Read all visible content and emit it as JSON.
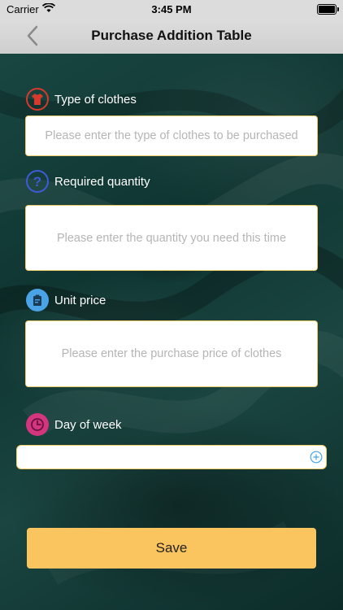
{
  "status_bar": {
    "carrier": "Carrier",
    "time": "3:45 PM"
  },
  "nav": {
    "title": "Purchase Addition Table"
  },
  "form": {
    "type": {
      "label": "Type of clothes",
      "placeholder": "Please enter the type of clothes to be purchased",
      "icon": "shirt-icon",
      "icon_color": "#d63a2c"
    },
    "quantity": {
      "label": "Required quantity",
      "placeholder": "Please enter the quantity you need this time",
      "icon": "question-icon",
      "icon_color": "#3d5bd8"
    },
    "price": {
      "label": "Unit price",
      "placeholder": "Please enter the purchase price of clothes",
      "icon": "clipboard-icon",
      "icon_color": "#4aa3e6"
    },
    "day": {
      "label": "Day of week",
      "icon": "clock-icon",
      "icon_color": "#d3367f",
      "add_icon": "plus-circle-icon"
    }
  },
  "save_label": "Save",
  "colors": {
    "accent": "#fac45e",
    "field_border": "#f1cc6a"
  }
}
